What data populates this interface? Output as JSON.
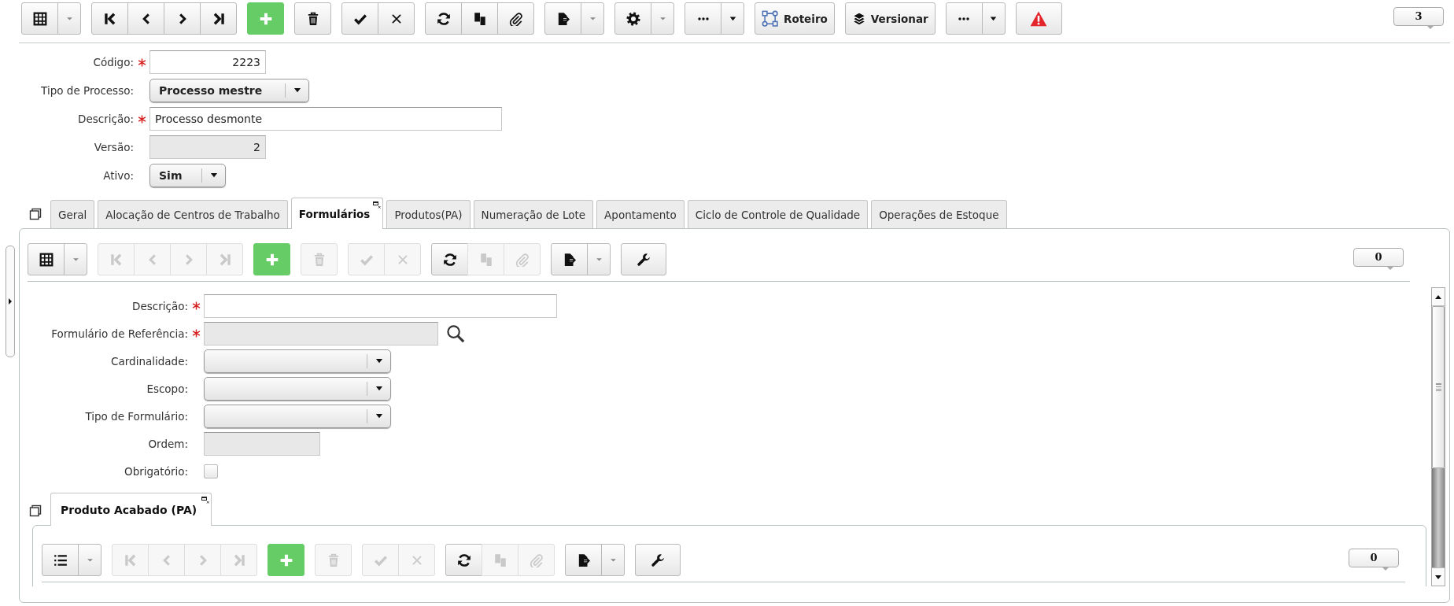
{
  "toolbar": {
    "groups": [
      {
        "buttons": [
          {
            "kind": "grid",
            "disabled": false
          },
          {
            "kind": "dropdown",
            "disabled": false
          }
        ]
      },
      {
        "buttons": [
          {
            "kind": "first",
            "disabled": false
          },
          {
            "kind": "prev",
            "disabled": false
          },
          {
            "kind": "next",
            "disabled": false
          },
          {
            "kind": "last",
            "disabled": false
          }
        ]
      },
      {
        "buttons": [
          {
            "kind": "add",
            "disabled": false
          }
        ]
      },
      {
        "buttons": [
          {
            "kind": "delete",
            "disabled": false
          }
        ]
      },
      {
        "buttons": [
          {
            "kind": "save",
            "disabled": false
          },
          {
            "kind": "cancel",
            "disabled": false
          }
        ]
      },
      {
        "buttons": [
          {
            "kind": "refresh",
            "disabled": false
          },
          {
            "kind": "copy",
            "disabled": false
          },
          {
            "kind": "attach",
            "disabled": false
          }
        ]
      },
      {
        "buttons": [
          {
            "kind": "export",
            "disabled": false
          },
          {
            "kind": "dropdown",
            "disabled": false
          }
        ]
      },
      {
        "buttons": [
          {
            "kind": "settings",
            "disabled": false
          },
          {
            "kind": "dropdown",
            "disabled": false
          }
        ]
      },
      {
        "buttons": [
          {
            "kind": "more",
            "disabled": false
          },
          {
            "kind": "menu",
            "disabled": false
          }
        ]
      },
      {
        "buttons": [
          {
            "kind": "flow",
            "label": "Roteiro",
            "disabled": false
          }
        ]
      },
      {
        "buttons": [
          {
            "kind": "layers",
            "label": "Versionar",
            "disabled": false
          }
        ]
      },
      {
        "buttons": [
          {
            "kind": "more",
            "disabled": false
          },
          {
            "kind": "menu",
            "disabled": false
          }
        ]
      },
      {
        "buttons": [
          {
            "kind": "alert",
            "disabled": false
          }
        ]
      }
    ],
    "counter": "3"
  },
  "form": {
    "fields": [
      {
        "label": "Código:",
        "kind": "number",
        "required": true,
        "value": "2223"
      },
      {
        "label": "Tipo de Processo:",
        "kind": "select",
        "required": false,
        "value": "Processo mestre"
      },
      {
        "label": "Descrição:",
        "kind": "text",
        "required": true,
        "value": "Processo desmonte"
      },
      {
        "label": "Versão:",
        "kind": "locked",
        "required": false,
        "value": "2"
      },
      {
        "label": "Ativo:",
        "kind": "select",
        "required": false,
        "value": "Sim"
      }
    ]
  },
  "tabs": [
    {
      "label": "Geral",
      "selected": false
    },
    {
      "label": "Alocação de Centros de Trabalho",
      "selected": false
    },
    {
      "label": "Formulários",
      "selected": true
    },
    {
      "label": "Produtos(PA)",
      "selected": false
    },
    {
      "label": "Numeração de Lote",
      "selected": false
    },
    {
      "label": "Apontamento",
      "selected": false
    },
    {
      "label": "Ciclo de Controle de Qualidade",
      "selected": false
    },
    {
      "label": "Operações de Estoque",
      "selected": false
    }
  ],
  "panel": {
    "toolbar": {
      "groups": [
        {
          "buttons": [
            {
              "kind": "grid",
              "disabled": false
            },
            {
              "kind": "dropdown",
              "disabled": false
            }
          ]
        },
        {
          "buttons": [
            {
              "kind": "first",
              "disabled": true
            },
            {
              "kind": "prev",
              "disabled": true
            },
            {
              "kind": "next",
              "disabled": true
            },
            {
              "kind": "last",
              "disabled": true
            }
          ]
        },
        {
          "buttons": [
            {
              "kind": "add",
              "disabled": false
            }
          ]
        },
        {
          "buttons": [
            {
              "kind": "delete",
              "disabled": true
            }
          ]
        },
        {
          "buttons": [
            {
              "kind": "save",
              "disabled": true
            },
            {
              "kind": "cancel",
              "disabled": true
            }
          ]
        },
        {
          "buttons": [
            {
              "kind": "refresh",
              "disabled": false
            },
            {
              "kind": "copy",
              "disabled": true
            },
            {
              "kind": "attach",
              "disabled": true
            }
          ]
        },
        {
          "buttons": [
            {
              "kind": "export",
              "disabled": false
            },
            {
              "kind": "dropdown",
              "disabled": false
            }
          ]
        },
        {
          "buttons": [
            {
              "kind": "wrench",
              "disabled": false
            }
          ]
        }
      ],
      "counter": "0"
    },
    "fields": [
      {
        "label": "Descrição:",
        "kind": "text",
        "required": true
      },
      {
        "label": "Formulário de Referência:",
        "kind": "lookup",
        "required": true
      },
      {
        "label": "Cardinalidade:",
        "kind": "select",
        "required": false
      },
      {
        "label": "Escopo:",
        "kind": "select",
        "required": false
      },
      {
        "label": "Tipo de Formulário:",
        "kind": "select",
        "required": false
      },
      {
        "label": "Ordem:",
        "kind": "locked",
        "required": false
      },
      {
        "label": "Obrigatório:",
        "kind": "checkbox",
        "required": false,
        "checked": false
      }
    ],
    "subtabs": [
      {
        "label": "Produto Acabado (PA)",
        "selected": true
      }
    ],
    "subpanel": {
      "toolbar": {
        "groups": [
          {
            "buttons": [
              {
                "kind": "list",
                "disabled": false
              },
              {
                "kind": "dropdown",
                "disabled": false
              }
            ]
          },
          {
            "buttons": [
              {
                "kind": "first",
                "disabled": true
              },
              {
                "kind": "prev",
                "disabled": true
              },
              {
                "kind": "next",
                "disabled": true
              },
              {
                "kind": "last",
                "disabled": true
              }
            ]
          },
          {
            "buttons": [
              {
                "kind": "add",
                "disabled": false
              }
            ]
          },
          {
            "buttons": [
              {
                "kind": "delete",
                "disabled": true
              }
            ]
          },
          {
            "buttons": [
              {
                "kind": "save",
                "disabled": true
              },
              {
                "kind": "cancel",
                "disabled": true
              }
            ]
          },
          {
            "buttons": [
              {
                "kind": "refresh",
                "disabled": false
              },
              {
                "kind": "copy",
                "disabled": true
              },
              {
                "kind": "attach",
                "disabled": true
              }
            ]
          },
          {
            "buttons": [
              {
                "kind": "export",
                "disabled": false
              },
              {
                "kind": "dropdown",
                "disabled": false
              }
            ]
          },
          {
            "buttons": [
              {
                "kind": "wrench",
                "disabled": false
              }
            ]
          }
        ],
        "counter": "0"
      }
    }
  }
}
